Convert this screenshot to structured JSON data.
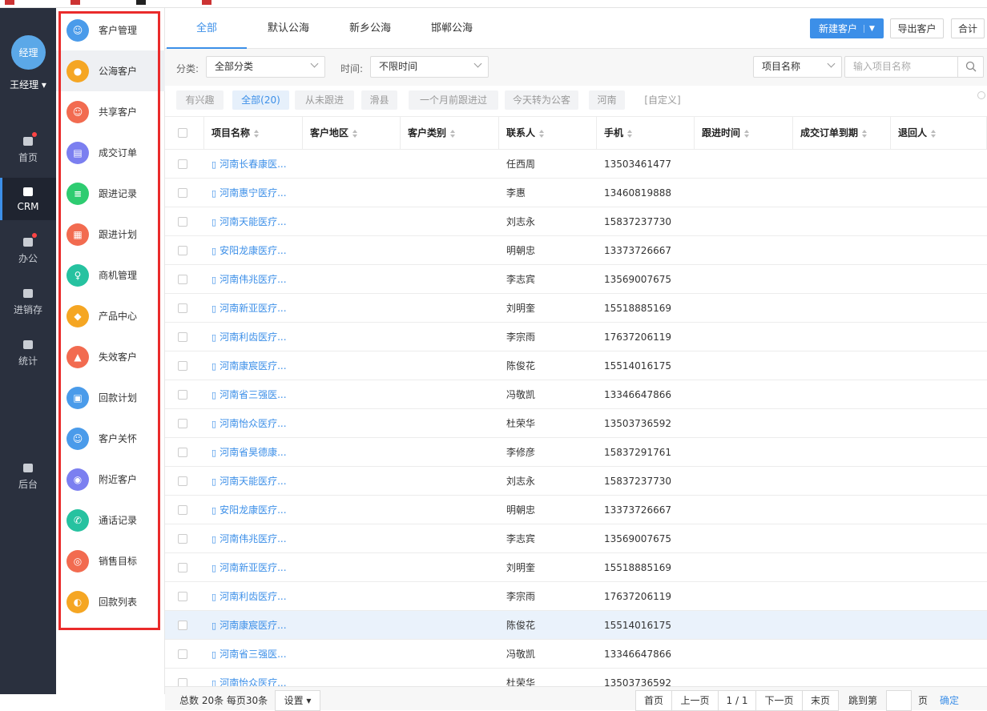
{
  "user": {
    "avatar_text": "经理",
    "name": "王经理"
  },
  "nav": [
    {
      "label": "首页",
      "icon": "home-icon",
      "dot": true
    },
    {
      "label": "CRM",
      "icon": "users-icon",
      "active": true
    },
    {
      "label": "办公",
      "icon": "briefcase-icon",
      "dot": true
    },
    {
      "label": "进销存",
      "icon": "warehouse-icon"
    },
    {
      "label": "统计",
      "icon": "pie-chart-icon"
    },
    {
      "label": "后台",
      "icon": "grid-icon"
    }
  ],
  "side": [
    {
      "label": "客户管理",
      "icon": "customers-icon",
      "color": "#4a9bea",
      "glyph": "☺"
    },
    {
      "label": "公海客户",
      "icon": "person-icon",
      "color": "#f5a623",
      "glyph": "●",
      "active": true
    },
    {
      "label": "共享客户",
      "icon": "share-user-icon",
      "color": "#f26b50",
      "glyph": "☺"
    },
    {
      "label": "成交订单",
      "icon": "order-icon",
      "color": "#7b7ff0",
      "glyph": "▤"
    },
    {
      "label": "跟进记录",
      "icon": "record-icon",
      "color": "#2ecc71",
      "glyph": "≡"
    },
    {
      "label": "跟进计划",
      "icon": "plan-icon",
      "color": "#f26b50",
      "glyph": "▦"
    },
    {
      "label": "商机管理",
      "icon": "bulb-icon",
      "color": "#26c2a0",
      "glyph": "♀"
    },
    {
      "label": "产品中心",
      "icon": "box-icon",
      "color": "#f5a623",
      "glyph": "◆"
    },
    {
      "label": "失效客户",
      "icon": "warning-icon",
      "color": "#f26b50",
      "glyph": "▲"
    },
    {
      "label": "回款计划",
      "icon": "payment-plan-icon",
      "color": "#4a9bea",
      "glyph": "▣"
    },
    {
      "label": "客户关怀",
      "icon": "care-icon",
      "color": "#4a9bea",
      "glyph": "☺"
    },
    {
      "label": "附近客户",
      "icon": "location-icon",
      "color": "#7b7ff0",
      "glyph": "◉"
    },
    {
      "label": "通话记录",
      "icon": "phone-icon",
      "color": "#26c2a0",
      "glyph": "✆"
    },
    {
      "label": "销售目标",
      "icon": "target-icon",
      "color": "#f26b50",
      "glyph": "◎"
    },
    {
      "label": "回款列表",
      "icon": "money-icon",
      "color": "#f5a623",
      "glyph": "◐"
    }
  ],
  "tabs": [
    "全部",
    "默认公海",
    "新乡公海",
    "邯郸公海"
  ],
  "toolbar": {
    "new_customer": "新建客户",
    "export": "导出客户",
    "merge": "合计"
  },
  "filter": {
    "category_label": "分类:",
    "category_value": "全部分类",
    "time_label": "时间:",
    "time_value": "不限时间",
    "field_value": "项目名称",
    "search_placeholder": "输入项目名称"
  },
  "tags": [
    "有兴趣",
    "全部(20)",
    "从未跟进",
    "滑县",
    "一个月前跟进过",
    "今天转为公客",
    "河南",
    "[自定义]"
  ],
  "columns": [
    "项目名称",
    "客户地区",
    "客户类别",
    "联系人",
    "手机",
    "跟进时间",
    "成交订单到期",
    "退回人"
  ],
  "rows": [
    {
      "name": "河南长春康医...",
      "contact": "任西周",
      "phone": "13503461477"
    },
    {
      "name": "河南惠宁医疗...",
      "contact": "李惠",
      "phone": "13460819888"
    },
    {
      "name": "河南天能医疗...",
      "contact": "刘志永",
      "phone": "15837237730"
    },
    {
      "name": "安阳龙康医疗...",
      "contact": "明朝忠",
      "phone": "13373726667"
    },
    {
      "name": "河南伟兆医疗...",
      "contact": "李志宾",
      "phone": "13569007675"
    },
    {
      "name": "河南新亚医疗...",
      "contact": "刘明奎",
      "phone": "15518885169"
    },
    {
      "name": "河南利齿医疗...",
      "contact": "李宗雨",
      "phone": "17637206119"
    },
    {
      "name": "河南康宸医疗...",
      "contact": "陈俊花",
      "phone": "15514016175"
    },
    {
      "name": "河南省三强医...",
      "contact": "冯敬凯",
      "phone": "13346647866"
    },
    {
      "name": "河南怡众医疗...",
      "contact": "杜荣华",
      "phone": "13503736592"
    },
    {
      "name": "河南省昊德康...",
      "contact": "李修彦",
      "phone": "15837291761"
    },
    {
      "name": "河南天能医疗...",
      "contact": "刘志永",
      "phone": "15837237730"
    },
    {
      "name": "安阳龙康医疗...",
      "contact": "明朝忠",
      "phone": "13373726667"
    },
    {
      "name": "河南伟兆医疗...",
      "contact": "李志宾",
      "phone": "13569007675"
    },
    {
      "name": "河南新亚医疗...",
      "contact": "刘明奎",
      "phone": "15518885169"
    },
    {
      "name": "河南利齿医疗...",
      "contact": "李宗雨",
      "phone": "17637206119"
    },
    {
      "name": "河南康宸医疗...",
      "contact": "陈俊花",
      "phone": "15514016175",
      "highlight": true
    },
    {
      "name": "河南省三强医...",
      "contact": "冯敬凯",
      "phone": "13346647866"
    },
    {
      "name": "河南怡众医疗...",
      "contact": "杜荣华",
      "phone": "13503736592"
    }
  ],
  "pagination": {
    "summary": "总数 20条 每页30条",
    "settings": "设置",
    "first": "首页",
    "prev": "上一页",
    "page": "1 / 1",
    "next": "下一页",
    "last": "末页",
    "goto": "跳到第",
    "page_unit": "页",
    "confirm": "确定"
  }
}
